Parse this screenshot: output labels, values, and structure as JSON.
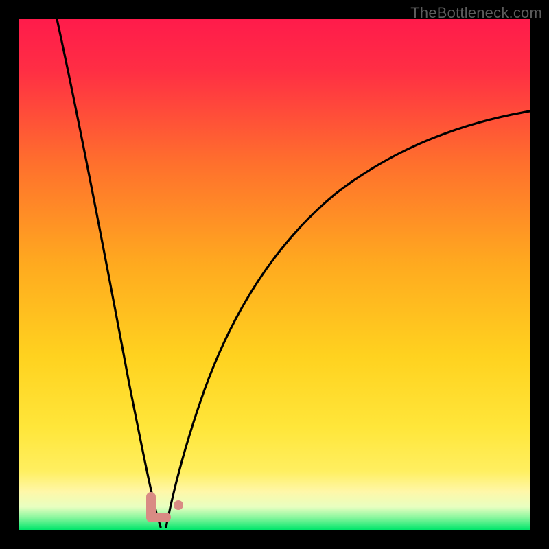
{
  "watermark": "TheBottleneck.com",
  "chart_data": {
    "type": "line",
    "title": "",
    "xlabel": "",
    "ylabel": "",
    "x_range": [
      0,
      100
    ],
    "y_range_percent_bottleneck": [
      0,
      100
    ],
    "gradient_colors": {
      "top": "#ff1b4b",
      "upper_mid": "#ff7a2a",
      "mid": "#ffd21f",
      "lower_mid": "#ffef60",
      "near_bottom": "#fff7a8",
      "bottom": "#00e66b"
    },
    "series": [
      {
        "name": "left-branch",
        "description": "Steep descending curve from top-left toward minimum",
        "x": [
          8,
          12,
          16,
          20,
          23,
          25,
          26.5,
          27.5
        ],
        "y_percent_from_top": [
          0,
          25,
          50,
          72,
          86,
          93,
          97,
          99.5
        ]
      },
      {
        "name": "right-branch",
        "description": "Rising curve from minimum toward upper-right, flattening",
        "x": [
          28.5,
          30,
          33,
          38,
          45,
          55,
          68,
          82,
          100
        ],
        "y_percent_from_top": [
          99.5,
          95,
          85,
          70,
          55,
          42,
          31,
          24,
          18
        ]
      }
    ],
    "minimum_marker": {
      "shape": "L",
      "color": "#d98b84",
      "approx_x": 27,
      "approx_y_percent_from_top": 98
    },
    "secondary_dot": {
      "color": "#d98b84",
      "approx_x": 31,
      "approx_y_percent_from_top": 96
    }
  }
}
